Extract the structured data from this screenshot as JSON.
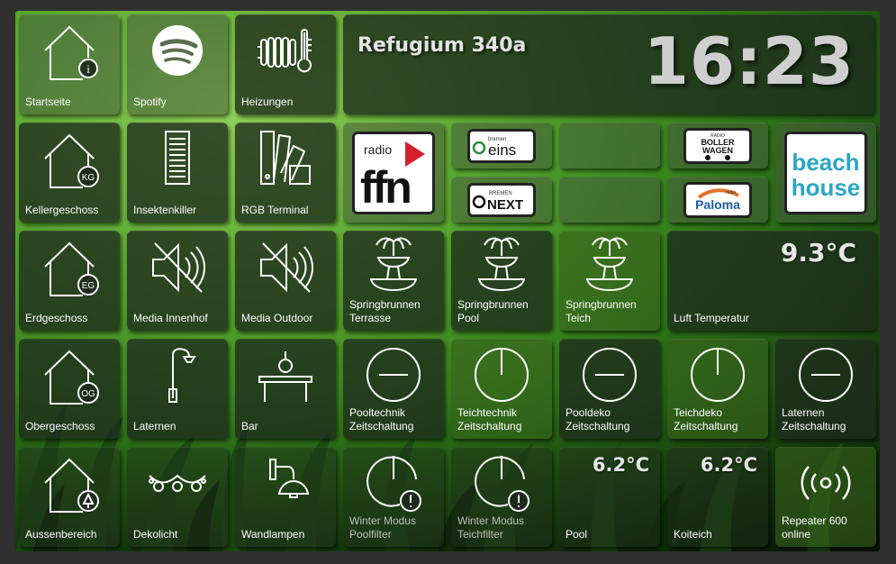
{
  "header": {
    "title": "Refugium 340a",
    "clock": "16:23"
  },
  "tiles": {
    "startseite": "Startseite",
    "spotify": "Spotify",
    "heizungen": "Heizungen",
    "kellergeschoss": "Kellergeschoss",
    "insektenkiller": "Insektenkiller",
    "rgb_terminal": "RGB Terminal",
    "erdgeschoss": "Erdgeschoss",
    "media_innenhof": "Media Innenhof",
    "media_outdoor": "Media Outdoor",
    "springbrunnen_terrasse": "Springbrunnen\nTerrasse",
    "springbrunnen_pool": "Springbrunnen\nPool",
    "springbrunnen_teich": "Springbrunnen\nTeich",
    "luft_temperatur": "Luft Temperatur",
    "obergeschoss": "Obergeschoss",
    "laternen": "Laternen",
    "bar": "Bar",
    "pooltechnik": "Pooltechnik\nZeitschaltung",
    "teichtechnik": "Teichtechnik\nZeitschaltung",
    "pooldeko": "Pooldeko\nZeitschaltung",
    "teichdeko": "Teichdeko\nZeitschaltung",
    "laternen_zeit": "Laternen\nZeitschaltung",
    "aussenbereich": "Aussenbereich",
    "dekolicht": "Dekolicht",
    "wandlampen": "Wandlampen",
    "winter_poolfilter": "Winter Modus\nPoolfilter",
    "winter_teichfilter": "Winter Modus\nTeichfilter",
    "pool": "Pool",
    "koiteich": "Koiteich",
    "repeater": "Repeater 600\nonline"
  },
  "values": {
    "luft_temp": "9.3°C",
    "pool_temp": "6.2°C",
    "koiteich_temp": "6.2°C"
  },
  "house_badges": {
    "startseite": "i",
    "keller": "KG",
    "erd": "EG",
    "ober": "OG"
  },
  "radio": {
    "ffn_top": "radio",
    "ffn_main": "ffn",
    "bremen_eins_small": "bremen",
    "bremen_eins_main": "eins",
    "bremen_next_small": "BREMEN",
    "bremen_next_main": "NEXT",
    "boller_small": "RADIO",
    "boller_main1": "BOLLER",
    "boller_main2": "WAGEN",
    "paloma_small": "radio",
    "paloma_main": "Paloma",
    "beach1": "beach",
    "beach2": "house"
  },
  "colors": {
    "accent_green": "#4a9a24",
    "tile_bg": "#1e2a1c",
    "text": "#ffffff",
    "temp_text": "#e6e6e6",
    "ffn_red": "#d3202b",
    "beach_cyan": "#2aa6c4"
  }
}
